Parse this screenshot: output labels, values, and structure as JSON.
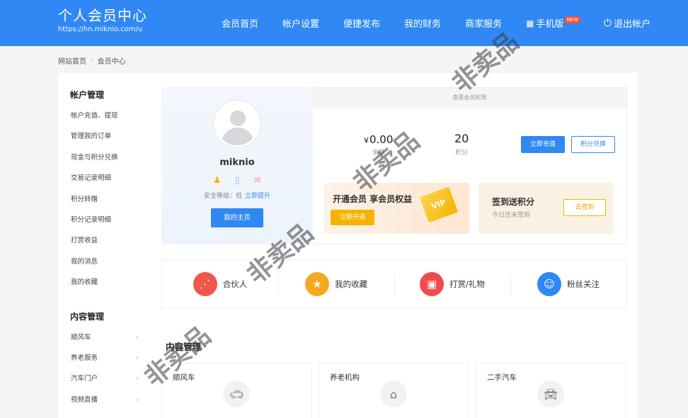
{
  "header": {
    "title": "个人会员中心",
    "url": "https://hn.miknio.com/u",
    "nav": [
      {
        "label": "会员首页"
      },
      {
        "label": "帐户设置"
      },
      {
        "label": "便捷发布"
      },
      {
        "label": "我的财务"
      },
      {
        "label": "商家服务"
      },
      {
        "label": "手机版",
        "badge": "NEW",
        "icon": "phone-grid-icon"
      },
      {
        "label": "退出帐户",
        "icon": "power-icon"
      }
    ]
  },
  "breadcrumb": [
    "网站首页",
    "会员中心"
  ],
  "sidebar": {
    "account_title": "帐户管理",
    "account_items": [
      "帐户充值、提现",
      "管理我的订单",
      "现金与积分兑换",
      "交易记录明细",
      "积分转赠",
      "积分记录明细",
      "打赏收益",
      "我的消息",
      "我的收藏"
    ],
    "content_title": "内容管理",
    "content_items": [
      "顺风车",
      "养老服务",
      "汽车门户",
      "视频直播"
    ]
  },
  "profile": {
    "username": "miknio",
    "security_label": "安全等级：低",
    "security_link": "立即提升",
    "home_button": "我的主页"
  },
  "finance": {
    "header": "查看会员权限",
    "currency": "¥",
    "balance": "0.00",
    "balance_label": "余额",
    "points": "20",
    "points_label": "积分",
    "recharge_button": "立即充值",
    "exchange_button": "积分兑换",
    "vip_title": "开通会员 享会员权益",
    "vip_button": "立即开通",
    "vip_badge": "VIP",
    "sign_title": "签到送积分",
    "sign_subtitle": "今日还未签到",
    "sign_button": "去签到"
  },
  "quick_links": [
    {
      "label": "合伙人",
      "icon": "share-icon",
      "color": "#f2554a"
    },
    {
      "label": "我的收藏",
      "icon": "star-icon",
      "color": "#f6a823"
    },
    {
      "label": "打赏/礼物",
      "icon": "gift-icon",
      "color": "#f24a4a"
    },
    {
      "label": "粉丝关注",
      "icon": "user-heart-icon",
      "color": "#2f88f3"
    }
  ],
  "content_section": {
    "title": "内容管理",
    "cards": [
      {
        "label": "顺风车",
        "icon": "car-icon"
      },
      {
        "label": "养老机构",
        "icon": "home-heart-icon"
      },
      {
        "label": "二手汽车",
        "icon": "car-front-icon"
      }
    ]
  },
  "watermark": "非卖品"
}
